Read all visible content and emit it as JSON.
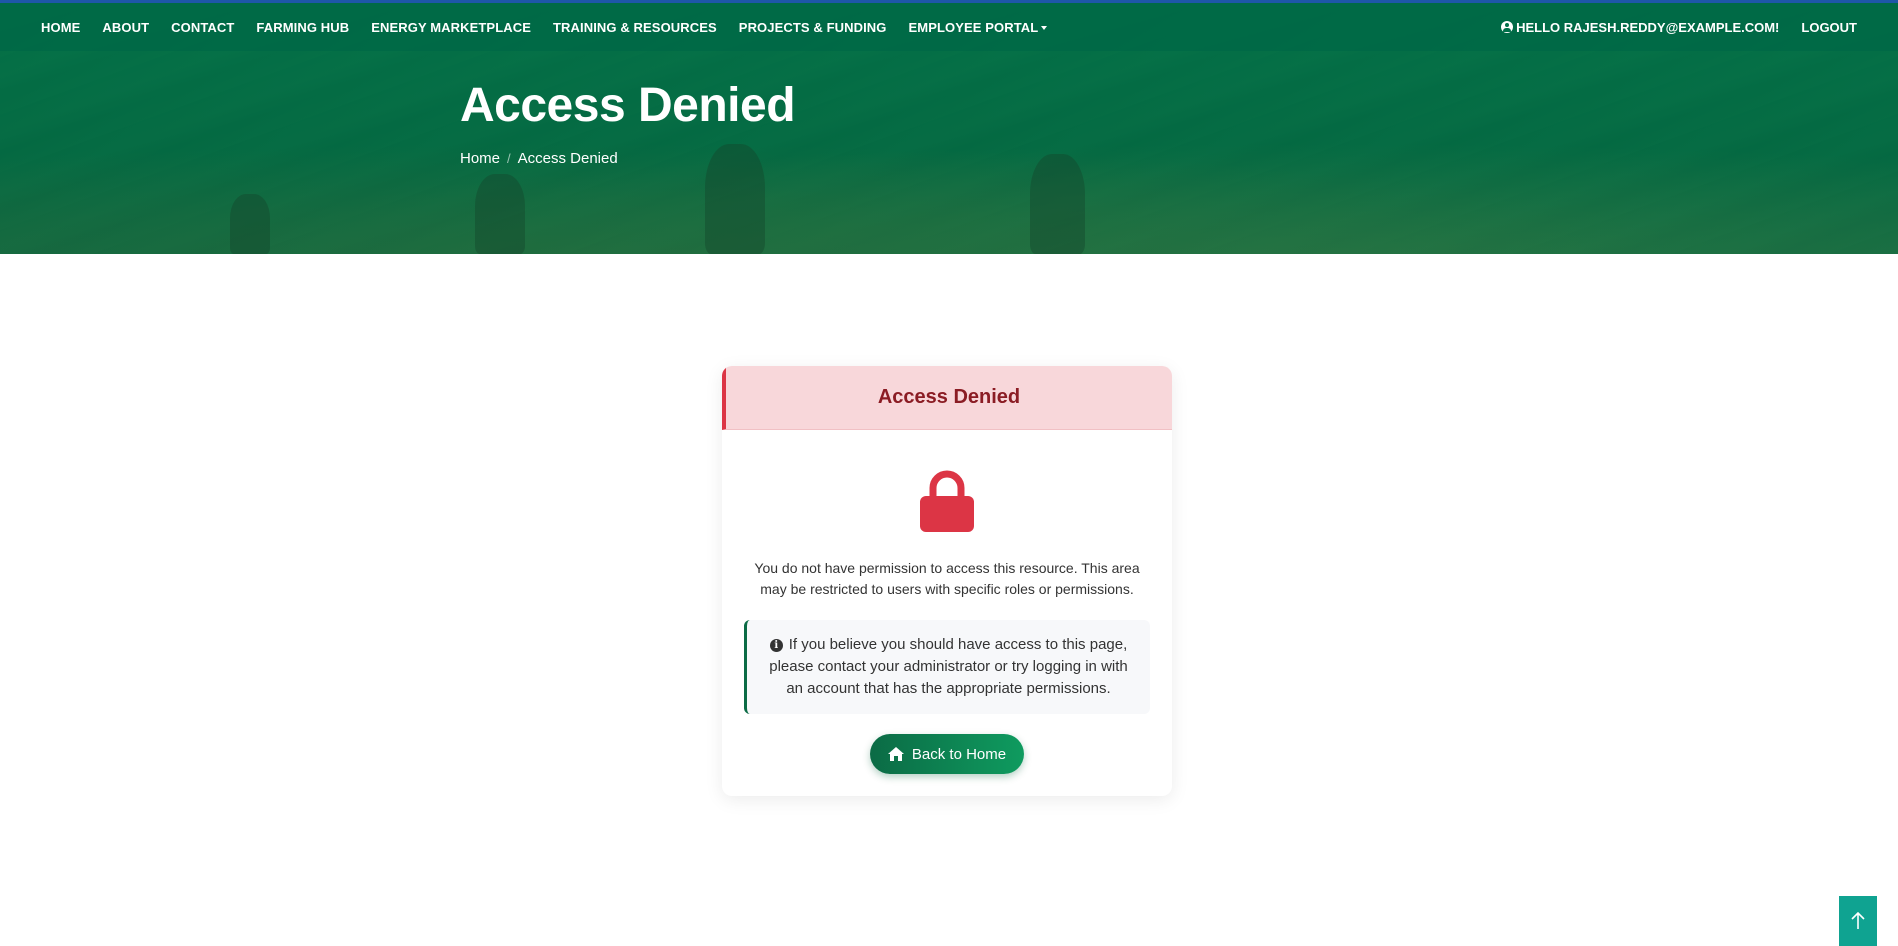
{
  "nav": {
    "links": [
      {
        "label": "HOME"
      },
      {
        "label": "ABOUT"
      },
      {
        "label": "CONTACT"
      },
      {
        "label": "FARMING HUB"
      },
      {
        "label": "ENERGY MARKETPLACE"
      },
      {
        "label": "TRAINING & RESOURCES"
      },
      {
        "label": "PROJECTS & FUNDING"
      },
      {
        "label": "EMPLOYEE PORTAL"
      }
    ],
    "user_greeting": "HELLO RAJESH.REDDY@EXAMPLE.COM!",
    "logout_label": "LOGOUT"
  },
  "hero": {
    "title": "Access Denied",
    "breadcrumb": {
      "home": "Home",
      "current": "Access Denied"
    }
  },
  "card": {
    "title": "Access Denied",
    "message": "You do not have permission to access this resource. This area may be restricted to users with specific roles or permissions.",
    "info": "If you believe you should have access to this page, please contact your administrator or try logging in with an account that has the appropriate permissions.",
    "button_label": "Back to Home"
  },
  "icons": {
    "lock": "lock-icon",
    "info": "info-circle-icon",
    "home": "home-icon",
    "user": "user-circle-icon",
    "top": "arrow-up-icon"
  },
  "colors": {
    "primary": "#00704a",
    "danger": "#dc3545",
    "danger_bg": "#f8d7da",
    "to_top": "#0fa391"
  }
}
